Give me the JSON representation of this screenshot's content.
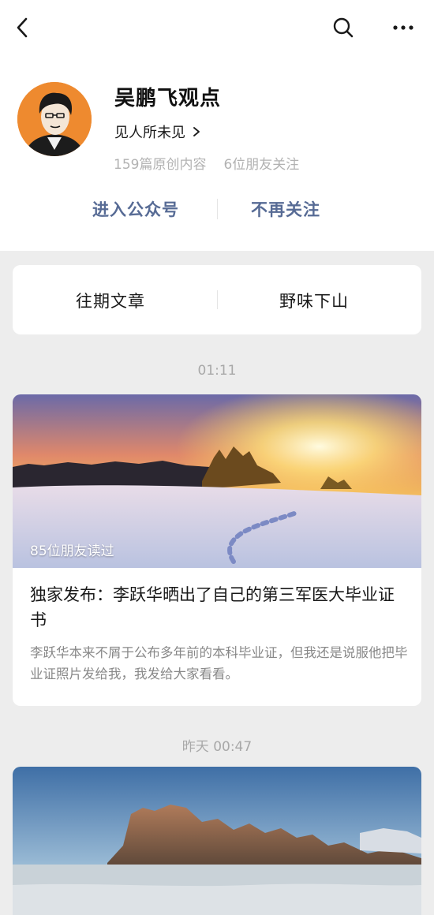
{
  "navbar": {
    "back_icon": "back-chevron-icon",
    "search_icon": "search-icon",
    "more_icon": "more-dots-icon"
  },
  "profile": {
    "name": "吴鹏飞观点",
    "slogan": "见人所未见",
    "original_count": "159篇原创内容",
    "friends_follow": "6位朋友关注"
  },
  "actions": {
    "enter": "进入公众号",
    "unfollow": "不再关注"
  },
  "menu": {
    "item1": "往期文章",
    "item2": "野味下山"
  },
  "feed": [
    {
      "time": "01:11",
      "read_by": "85位朋友读过",
      "title": "独家发布：李跃华晒出了自己的第三军医大毕业证书",
      "digest": "李跃华本来不屑于公布多年前的本科毕业证，但我还是说服他把毕业证照片发给我，我发给大家看看。"
    },
    {
      "time": "昨天 00:47"
    }
  ],
  "colors": {
    "link": "#576b95",
    "background": "#ededed",
    "card": "#ffffff",
    "avatar_bg": "#ee8a2f"
  }
}
